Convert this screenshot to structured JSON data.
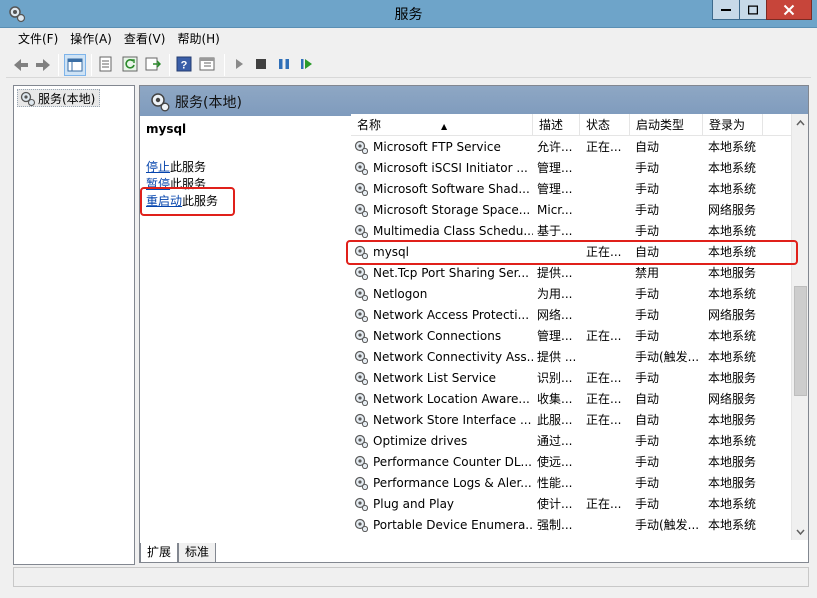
{
  "window": {
    "title": "服务"
  },
  "menu": [
    "文件(F)",
    "操作(A)",
    "查看(V)",
    "帮助(H)"
  ],
  "tree": {
    "root_label": "服务(本地)"
  },
  "pane": {
    "header_title": "服务(本地)",
    "selected_service": "mysql",
    "actions": [
      {
        "link": "停止",
        "text": "此服务"
      },
      {
        "link": "暂停",
        "text": "此服务"
      },
      {
        "link": "重启动",
        "text": "此服务"
      }
    ]
  },
  "columns": [
    "名称",
    "描述",
    "状态",
    "启动类型",
    "登录为"
  ],
  "rows": [
    [
      "Microsoft FTP Service",
      "允许...",
      "正在...",
      "自动",
      "本地系统"
    ],
    [
      "Microsoft iSCSI Initiator ...",
      "管理...",
      "",
      "手动",
      "本地系统"
    ],
    [
      "Microsoft Software Shad...",
      "管理...",
      "",
      "手动",
      "本地系统"
    ],
    [
      "Microsoft Storage Space...",
      "Micr...",
      "",
      "手动",
      "网络服务"
    ],
    [
      "Multimedia Class Schedu...",
      "基于...",
      "",
      "手动",
      "本地系统"
    ],
    [
      "mysql",
      "",
      "正在...",
      "自动",
      "本地系统"
    ],
    [
      "Net.Tcp Port Sharing Ser...",
      "提供...",
      "",
      "禁用",
      "本地服务"
    ],
    [
      "Netlogon",
      "为用...",
      "",
      "手动",
      "本地系统"
    ],
    [
      "Network Access Protecti...",
      "网络...",
      "",
      "手动",
      "网络服务"
    ],
    [
      "Network Connections",
      "管理...",
      "正在...",
      "手动",
      "本地系统"
    ],
    [
      "Network Connectivity Ass...",
      "提供 ...",
      "",
      "手动(触发...",
      "本地系统"
    ],
    [
      "Network List Service",
      "识别...",
      "正在...",
      "手动",
      "本地服务"
    ],
    [
      "Network Location Aware...",
      "收集...",
      "正在...",
      "自动",
      "网络服务"
    ],
    [
      "Network Store Interface ...",
      "此服...",
      "正在...",
      "自动",
      "本地服务"
    ],
    [
      "Optimize drives",
      "通过...",
      "",
      "手动",
      "本地系统"
    ],
    [
      "Performance Counter DL...",
      "使远...",
      "",
      "手动",
      "本地服务"
    ],
    [
      "Performance Logs & Aler...",
      "性能...",
      "",
      "手动",
      "本地服务"
    ],
    [
      "Plug and Play",
      "使计...",
      "正在...",
      "手动",
      "本地系统"
    ],
    [
      "Portable Device Enumera...",
      "强制...",
      "",
      "手动(触发...",
      "本地系统"
    ]
  ],
  "tabs": [
    "扩展",
    "标准"
  ],
  "colors": {
    "titlebar": "#6ea4c9",
    "highlight": "#e0201a",
    "link": "#0645ad",
    "pane_header": "#8ea7c4"
  }
}
